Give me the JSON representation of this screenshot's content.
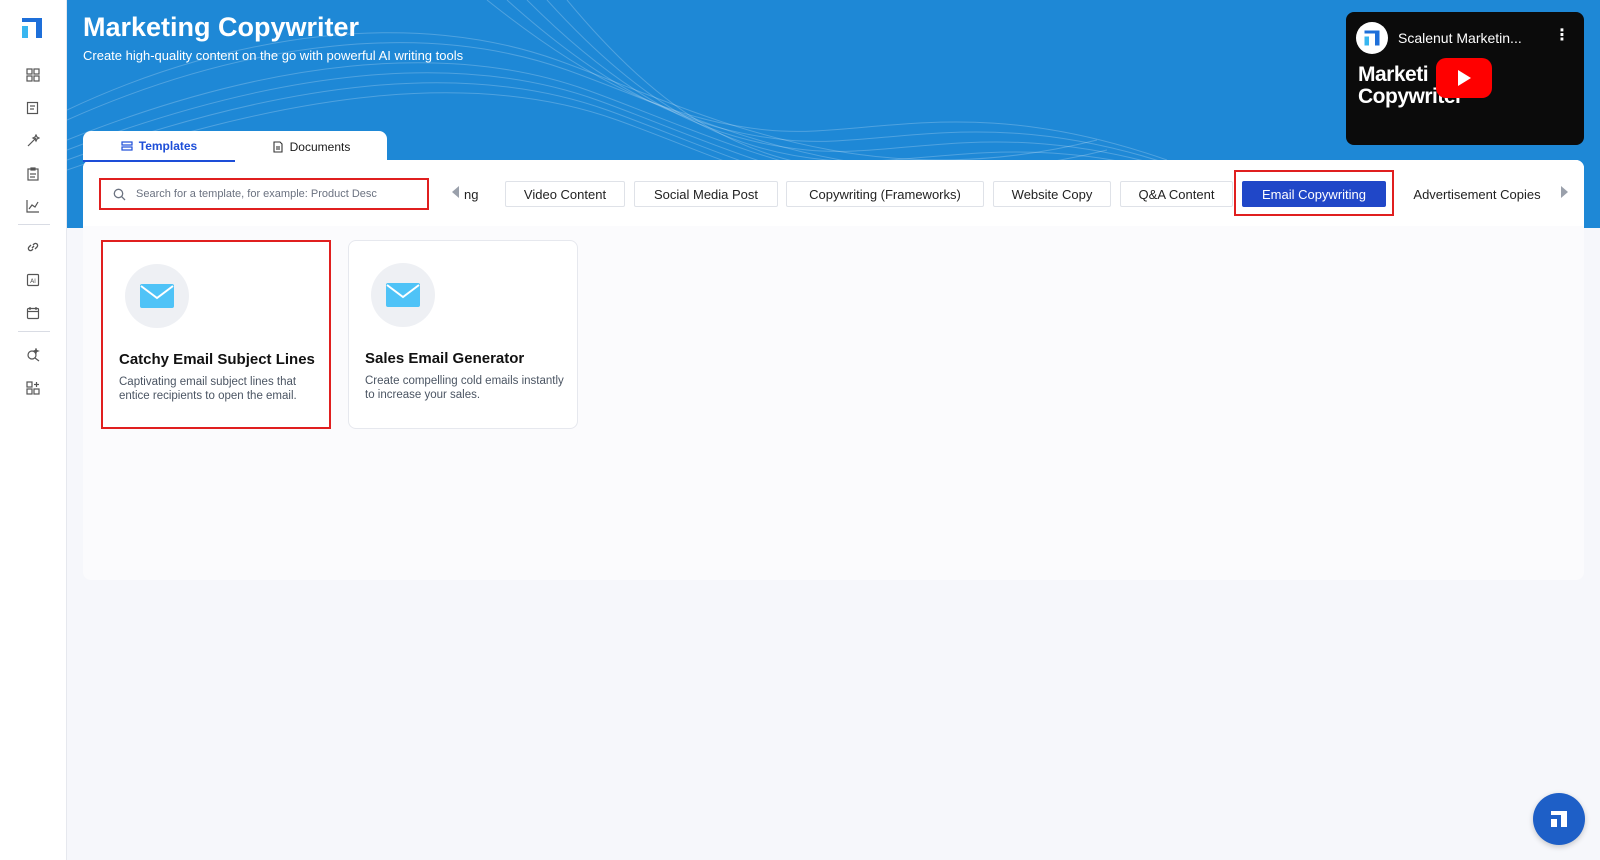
{
  "header": {
    "title": "Marketing Copywriter",
    "subtitle": "Create high-quality content on the go with powerful AI writing tools"
  },
  "video": {
    "channel_title": "Scalenut Marketin...",
    "thumbnail_text_line1": "Marketi",
    "thumbnail_text_line2": "Copywriter"
  },
  "tabs": [
    {
      "label": "Templates",
      "icon": "templates-icon",
      "active": true
    },
    {
      "label": "Documents",
      "icon": "document-icon",
      "active": false
    }
  ],
  "search": {
    "placeholder": "Search for a template, for example: Product Desc",
    "value": ""
  },
  "categories": {
    "partial_first": "ng",
    "items": [
      {
        "label": "Video Content",
        "active": false
      },
      {
        "label": "Social Media Post",
        "active": false
      },
      {
        "label": "Copywriting (Frameworks)",
        "active": false
      },
      {
        "label": "Website Copy",
        "active": false
      },
      {
        "label": "Q&A Content",
        "active": false
      },
      {
        "label": "Email Copywriting",
        "active": true
      },
      {
        "label": "Advertisement Copies",
        "active": false
      }
    ]
  },
  "cards": [
    {
      "title": "Catchy Email Subject Lines",
      "description": "Captivating email subject lines that entice recipients to open the email.",
      "icon": "mail-icon"
    },
    {
      "title": "Sales Email Generator",
      "description": "Create compelling cold emails instantly to increase your sales.",
      "icon": "mail-icon"
    }
  ],
  "colors": {
    "banner": "#1e88d6",
    "accent": "#2047c8",
    "highlight": "#e01f1f"
  }
}
